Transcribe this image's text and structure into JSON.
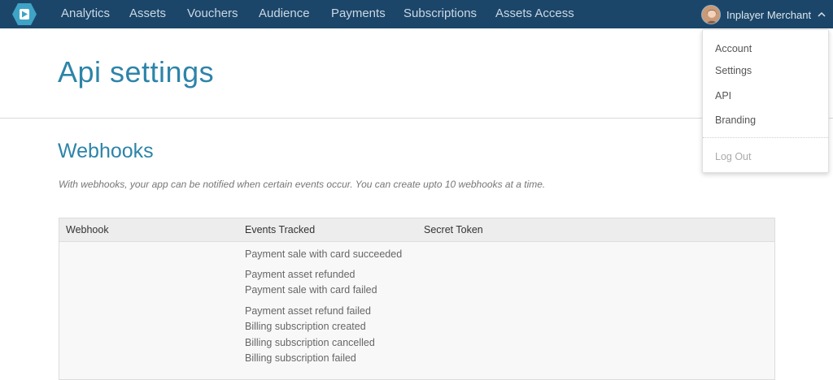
{
  "nav": {
    "items": [
      "Analytics",
      "Assets",
      "Vouchers",
      "Audience",
      "Payments",
      "Subscriptions",
      "Assets Access"
    ]
  },
  "user": {
    "name": "Inplayer Merchant"
  },
  "dropdown": {
    "items": [
      "Account",
      "Settings",
      "API",
      "Branding"
    ],
    "logout": "Log Out"
  },
  "page": {
    "title": "Api settings",
    "section_title": "Webhooks",
    "description": "With webhooks, your app can be notified when certain events occur. You can create upto 10 webhooks at a time."
  },
  "table": {
    "headers": [
      "Webhook",
      "Events Tracked",
      "Secret Token"
    ],
    "events": [
      "Payment sale with card succeeded",
      "Payment asset refunded",
      "Payment sale with card failed",
      "Payment asset refund failed",
      "Billing subscription created",
      "Billing subscription cancelled",
      "Billing subscription failed"
    ]
  },
  "colors": {
    "topbar": "#1c4669",
    "accent": "#2d84a9",
    "logo": "#3fa3c6"
  }
}
